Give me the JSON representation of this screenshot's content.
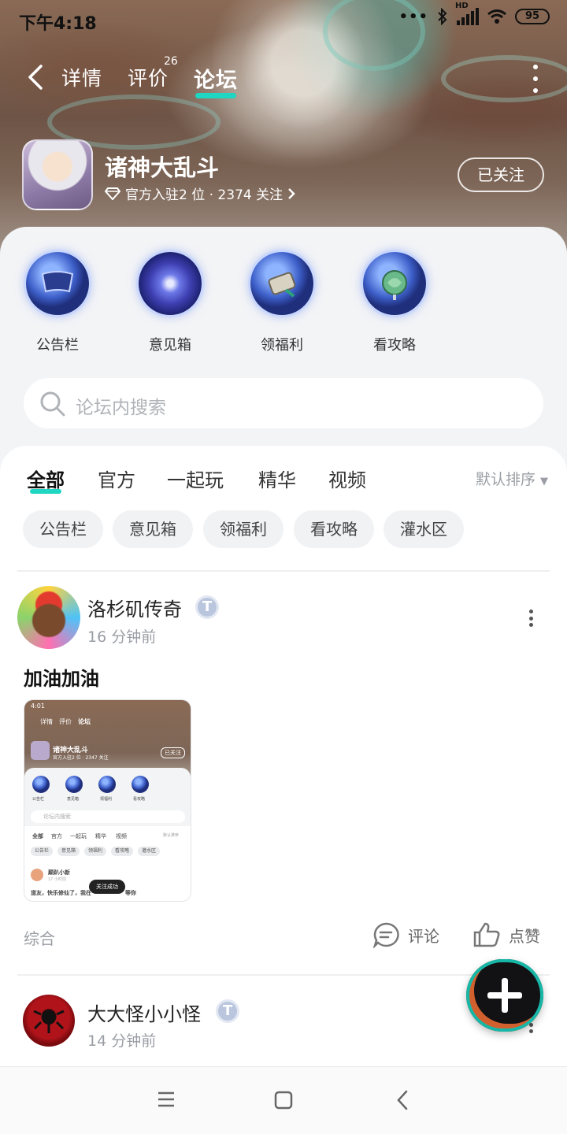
{
  "status_bar": {
    "time": "下午4:18",
    "battery": "95",
    "network_badge": "HD"
  },
  "nav": {
    "tabs": [
      {
        "label": "详情"
      },
      {
        "label": "评价",
        "count": "26"
      },
      {
        "label": "论坛"
      }
    ],
    "active_tab": "论坛"
  },
  "game": {
    "title": "诸神大乱斗",
    "meta": "官方入驻2 位 · 2374 关注",
    "follow_label": "已关注"
  },
  "quick_links": [
    {
      "label": "公告栏",
      "icon": "bulletin-icon"
    },
    {
      "label": "意见箱",
      "icon": "suggestion-icon"
    },
    {
      "label": "领福利",
      "icon": "gift-scroll-icon"
    },
    {
      "label": "看攻略",
      "icon": "guide-icon"
    }
  ],
  "search": {
    "placeholder": "论坛内搜索"
  },
  "forum_tabs": [
    "全部",
    "官方",
    "一起玩",
    "精华",
    "视频"
  ],
  "sort_label": "默认排序",
  "chips": [
    "公告栏",
    "意见箱",
    "领福利",
    "看攻略",
    "灌水区"
  ],
  "posts": [
    {
      "author": "洛杉矶传奇",
      "time": "16 分钟前",
      "title": "加油加油",
      "category": "综合",
      "comment_label": "评论",
      "like_label": "点赞",
      "thumbnail": {
        "status_time": "4:01",
        "tabs": [
          "详情",
          "评价",
          "论坛"
        ],
        "game_title": "诸神大乱斗",
        "game_meta": "官方入驻2 位 · 2347 关注",
        "follow": "已关注",
        "quick": [
          "公告栏",
          "意见箱",
          "领福利",
          "看攻略"
        ],
        "search": "论坛内搜索",
        "tabs2": [
          "全部",
          "官方",
          "一起玩",
          "精华",
          "视频"
        ],
        "sort": "默认排序",
        "chips": [
          "公告栏",
          "意见箱",
          "领福利",
          "看攻略",
          "灌水区"
        ],
        "author": "颠趴小新",
        "time": "17 小时前",
        "text": "道友，快乐修仙了，我在",
        "text_tail": "等你",
        "toast": "关注成功"
      }
    },
    {
      "author": "大大怪小小怪",
      "time": "14 分钟前"
    }
  ],
  "colors": {
    "accent": "#1fd6c3",
    "fab_ring": "#17b7a8",
    "fab_ring_warm": "#f56e32"
  }
}
